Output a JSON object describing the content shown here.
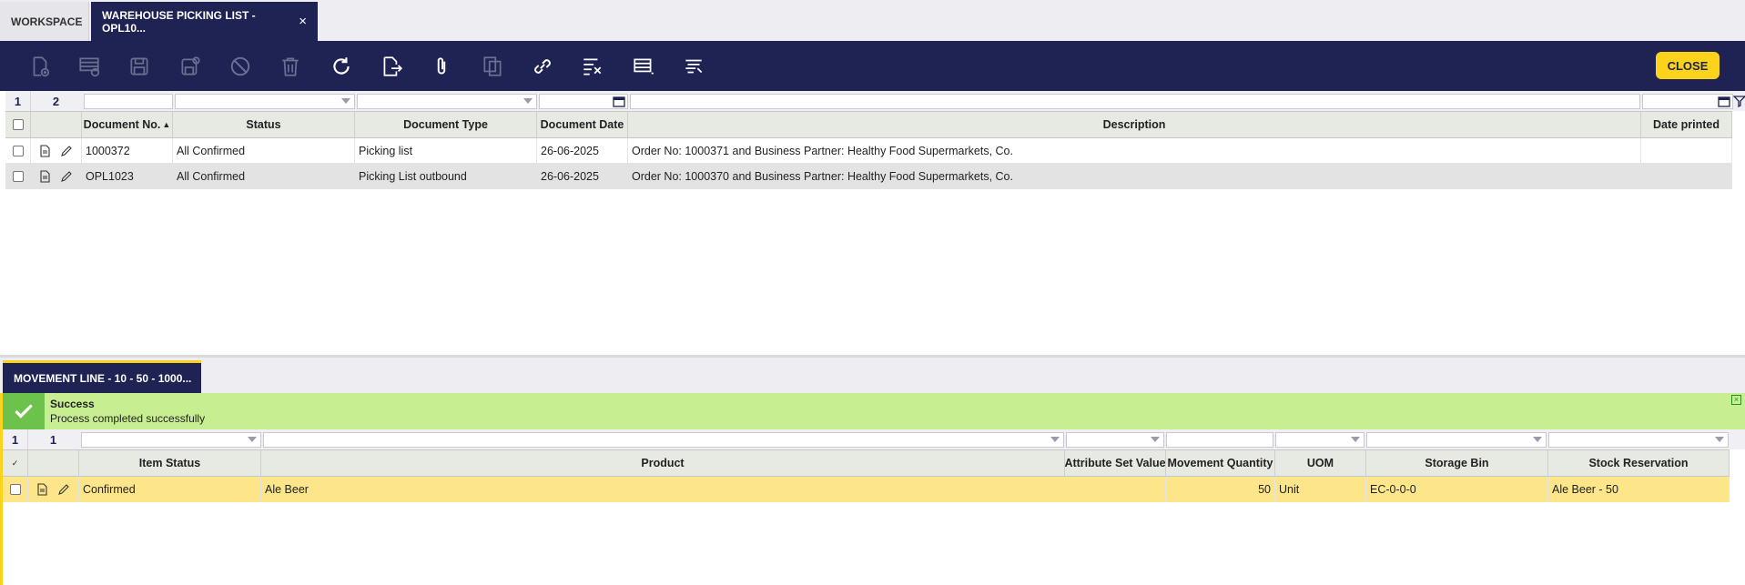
{
  "tabs": {
    "workspace": "WORKSPACE",
    "active": "WAREHOUSE PICKING LIST - OPL10...",
    "close_symbol": "×"
  },
  "toolbar": {
    "icons": [
      "new-document-icon",
      "new-row-icon",
      "save-icon",
      "save-close-icon",
      "cancel-icon",
      "delete-icon",
      "refresh-icon",
      "export-icon",
      "attachment-icon",
      "copy-record-icon",
      "link-icon",
      "process-icon",
      "grid-view-icon",
      "filter-list-icon"
    ],
    "close_label": "CLOSE"
  },
  "header_grid": {
    "selected_count": "1",
    "total_count": "2",
    "columns": [
      "Document No.",
      "Status",
      "Document Type",
      "Document Date",
      "Description",
      "Date printed"
    ],
    "sort_indicator": "▲",
    "rows": [
      {
        "doc_no": "1000372",
        "status": "All Confirmed",
        "doc_type": "Picking list",
        "doc_date": "26-06-2025",
        "description": "Order No: 1000371 and Business Partner: Healthy Food Supermarkets, Co.",
        "date_printed": ""
      },
      {
        "doc_no": "OPL1023",
        "status": "All Confirmed",
        "doc_type": "Picking List outbound",
        "doc_date": "26-06-2025",
        "description": "Order No: 1000370 and Business Partner: Healthy Food Supermarkets, Co.",
        "date_printed": ""
      }
    ]
  },
  "sub_tab": {
    "label": "MOVEMENT LINE - 10 - 50 - 1000..."
  },
  "message": {
    "title": "Success",
    "text": "Process completed successfully"
  },
  "line_grid": {
    "selected_count": "1",
    "total_count": "1",
    "columns": [
      "Item Status",
      "Product",
      "Attribute Set Value",
      "Movement Quantity",
      "UOM",
      "Storage Bin",
      "Stock Reservation"
    ],
    "rows": [
      {
        "item_status": "Confirmed",
        "product": "Ale Beer",
        "attribute_set": "",
        "quantity": "50",
        "uom": "Unit",
        "storage_bin": "EC-0-0-0",
        "reservation": "Ale Beer - 50"
      }
    ]
  },
  "colors": {
    "navy": "#1f2353",
    "accent_yellow": "#fbd21c",
    "success_bg": "#c7ee91",
    "selected_row": "#fde68a"
  }
}
